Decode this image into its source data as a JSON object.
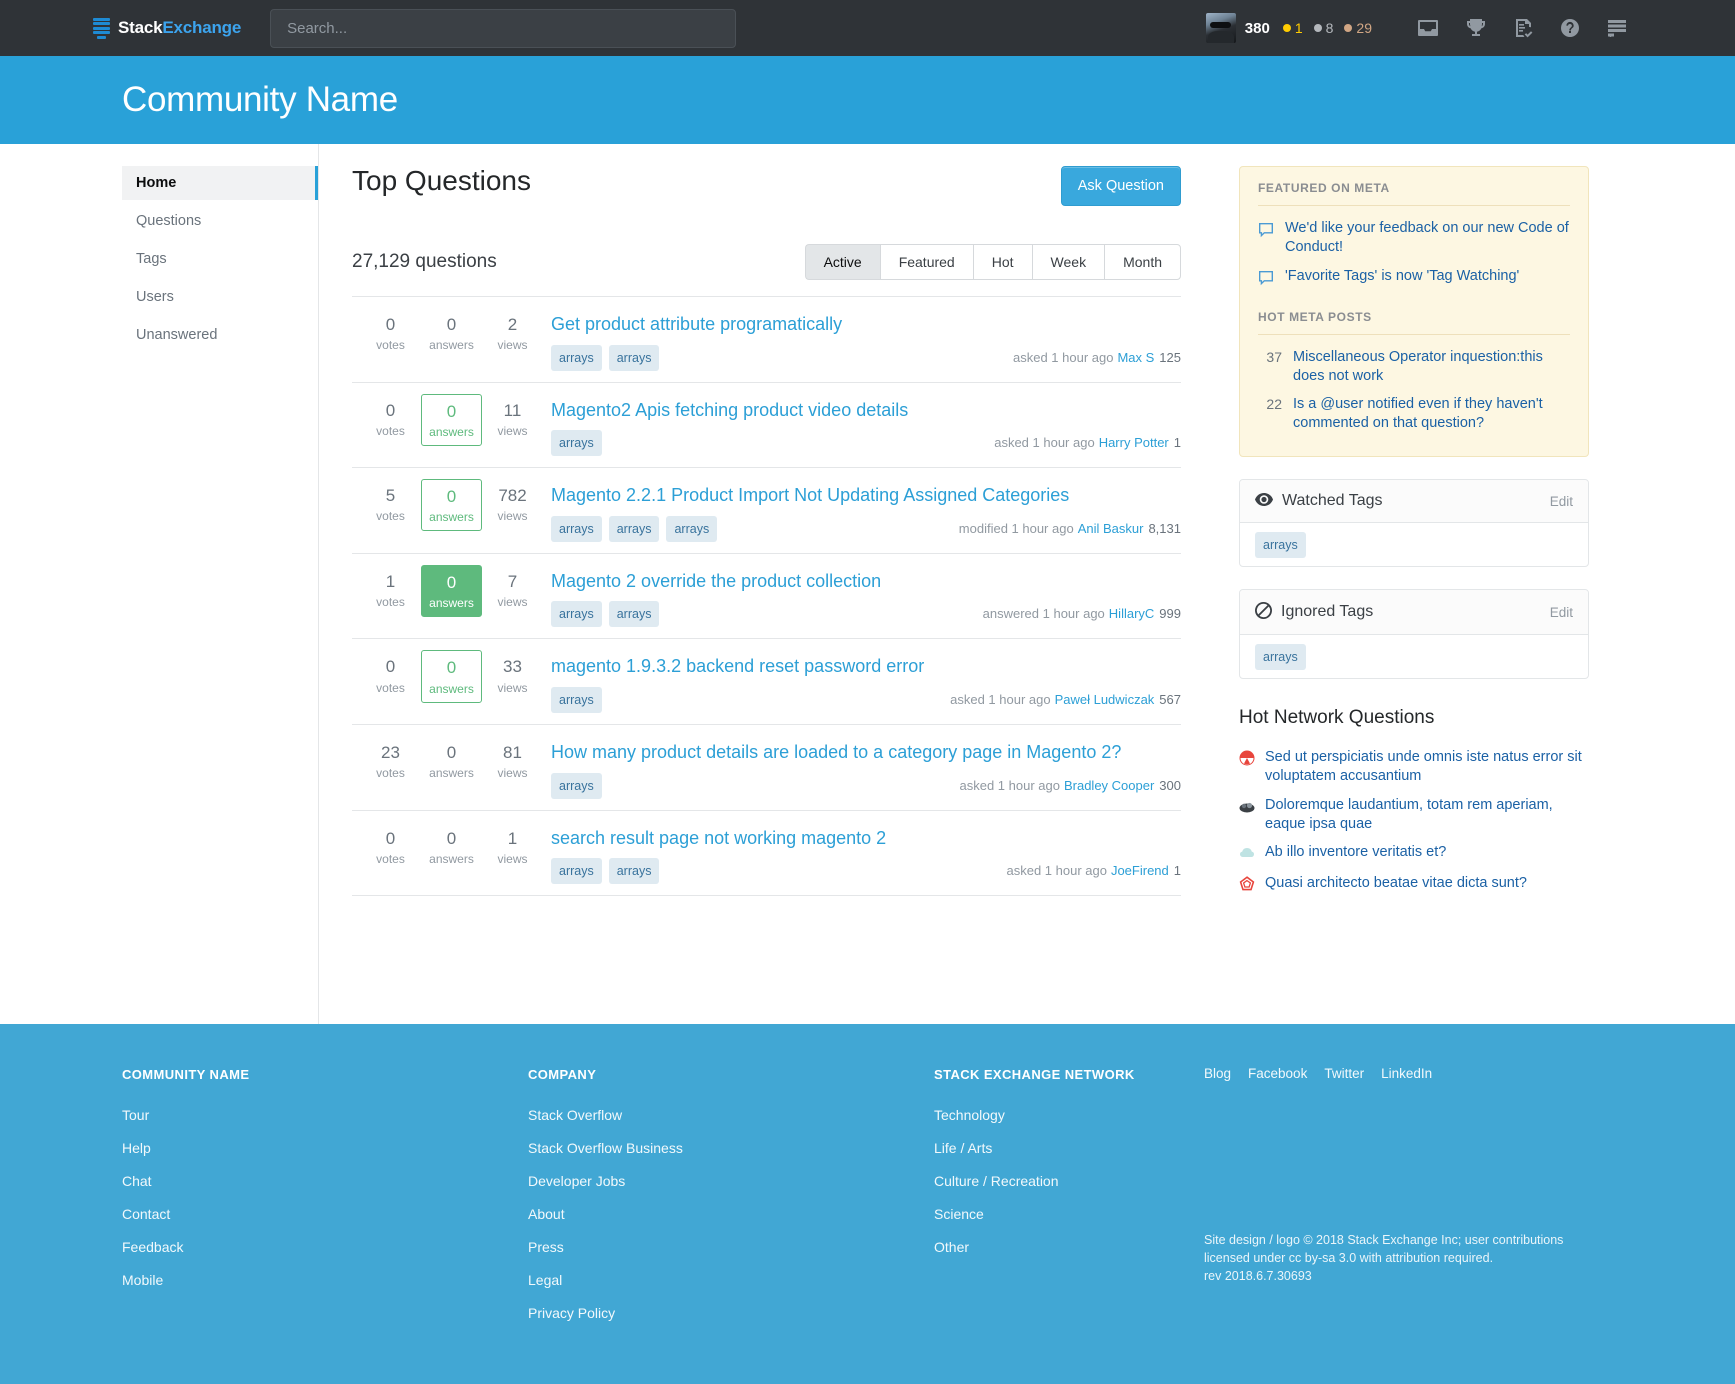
{
  "topbar": {
    "logo": {
      "part1": "Stack",
      "part2": "Exchange"
    },
    "search": {
      "placeholder": "Search...",
      "value": ""
    },
    "user": {
      "reputation": "380",
      "gold": "1",
      "silver": "8",
      "bronze": "29"
    },
    "icons": [
      "inbox-icon",
      "trophy-icon",
      "review-icon",
      "help-icon",
      "site-switcher-icon"
    ]
  },
  "community": {
    "title": "Community Name"
  },
  "sidebar": {
    "items": [
      {
        "label": "Home",
        "active": true
      },
      {
        "label": "Questions",
        "active": false
      },
      {
        "label": "Tags",
        "active": false
      },
      {
        "label": "Users",
        "active": false
      },
      {
        "label": "Unanswered",
        "active": false
      }
    ]
  },
  "main": {
    "title": "Top Questions",
    "ask_button": "Ask Question",
    "question_count": "27,129 questions",
    "tabs": [
      {
        "label": "Active",
        "active": true
      },
      {
        "label": "Featured",
        "active": false
      },
      {
        "label": "Hot",
        "active": false
      },
      {
        "label": "Week",
        "active": false
      },
      {
        "label": "Month",
        "active": false
      }
    ],
    "labels": {
      "votes": "votes",
      "answers": "answers",
      "views": "views"
    },
    "questions": [
      {
        "votes": "0",
        "answers": "0",
        "views": "2",
        "answer_state": "none",
        "title": "Get product attribute programatically",
        "tags": [
          "arrays",
          "arrays"
        ],
        "action": "asked 1 hour ago",
        "user": "Max S",
        "rep": "125"
      },
      {
        "votes": "0",
        "answers": "0",
        "views": "11",
        "answer_state": "outline",
        "title": "Magento2 Apis fetching product video details",
        "tags": [
          "arrays"
        ],
        "action": "asked 1 hour ago",
        "user": "Harry Potter",
        "rep": "1"
      },
      {
        "votes": "5",
        "answers": "0",
        "views": "782",
        "answer_state": "outline",
        "title": "Magento 2.2.1 Product Import Not Updating Assigned Categories",
        "tags": [
          "arrays",
          "arrays",
          "arrays"
        ],
        "action": "modified 1 hour ago",
        "user": "Anil Baskur",
        "rep": "8,131"
      },
      {
        "votes": "1",
        "answers": "0",
        "views": "7",
        "answer_state": "solid",
        "title": "Magento 2 override the product collection",
        "tags": [
          "arrays",
          "arrays"
        ],
        "action": "answered 1 hour ago",
        "user": "HillaryC",
        "rep": "999"
      },
      {
        "votes": "0",
        "answers": "0",
        "views": "33",
        "answer_state": "outline",
        "title": "magento 1.9.3.2 backend reset password error",
        "tags": [
          "arrays"
        ],
        "action": "asked 1 hour ago",
        "user": "Paweł Ludwiczak",
        "rep": "567"
      },
      {
        "votes": "23",
        "answers": "0",
        "views": "81",
        "answer_state": "none",
        "title": "How many product details are loaded to a category page in Magento 2?",
        "tags": [
          "arrays"
        ],
        "action": "asked 1 hour ago",
        "user": "Bradley Cooper",
        "rep": "300"
      },
      {
        "votes": "0",
        "answers": "0",
        "views": "1",
        "answer_state": "none",
        "title": "search result page not working magento 2",
        "tags": [
          "arrays",
          "arrays"
        ],
        "action": "asked 1 hour ago",
        "user": "JoeFirend",
        "rep": "1"
      }
    ]
  },
  "rightbar": {
    "featured_heading": "FEATURED ON META",
    "featured": [
      {
        "text": "We'd like your feedback on our new Code of Conduct!"
      },
      {
        "text": "'Favorite Tags' is now 'Tag Watching'"
      }
    ],
    "hot_meta_heading": "HOT META POSTS",
    "hot_meta": [
      {
        "votes": "37",
        "text": "Miscellaneous Operator inquestion:this does not work"
      },
      {
        "votes": "22",
        "text": "Is a @user notified even if they haven't commented on that question?"
      }
    ],
    "watched_tags": {
      "title": "Watched Tags",
      "edit": "Edit",
      "tags": [
        "arrays"
      ]
    },
    "ignored_tags": {
      "title": "Ignored Tags",
      "edit": "Edit",
      "tags": [
        "arrays"
      ]
    },
    "hot_network": {
      "title": "Hot Network Questions",
      "items": [
        {
          "text": "Sed ut perspiciatis unde omnis iste natus error sit voluptatem accusantium",
          "icon": "movies-icon",
          "color": "#e8453c"
        },
        {
          "text": "Doloremque laudantium, totam rem aperiam, eaque ipsa quae",
          "icon": "serverfault-icon",
          "color": "#3b4045"
        },
        {
          "text": "Ab illo inventore veritatis et?",
          "icon": "cloud-icon",
          "color": "#bfe3e3"
        },
        {
          "text": "Quasi architecto beatae vitae dicta sunt?",
          "icon": "rpg-icon",
          "color": "#e8453c"
        }
      ]
    }
  },
  "footer": {
    "col1": {
      "heading": "COMMUNITY NAME",
      "links": [
        "Tour",
        "Help",
        "Chat",
        "Contact",
        "Feedback",
        "Mobile"
      ]
    },
    "col2": {
      "heading": "COMPANY",
      "links": [
        "Stack Overflow",
        "Stack Overflow Business",
        "Developer Jobs",
        "About",
        "Press",
        "Legal",
        "Privacy Policy"
      ]
    },
    "col3": {
      "heading": "STACK EXCHANGE NETWORK",
      "links": [
        "Technology",
        "Life / Arts",
        "Culture / Recreation",
        "Science",
        "Other"
      ]
    },
    "social": [
      "Blog",
      "Facebook",
      "Twitter",
      "LinkedIn"
    ],
    "copyright_line1": "Site design / logo © 2018 Stack Exchange Inc; user contributions",
    "copyright_line2": "licensed under cc by-sa 3.0 with attribution required.",
    "copyright_line3": "rev 2018.6.7.30693"
  },
  "colors": {
    "brand_blue": "#29a1d8",
    "topbar_dark": "#2f3337",
    "link_blue": "#2c9fd6",
    "green": "#5eba7d",
    "meta_bg": "#fdf7e2",
    "footer_blue": "#41a7d4"
  }
}
